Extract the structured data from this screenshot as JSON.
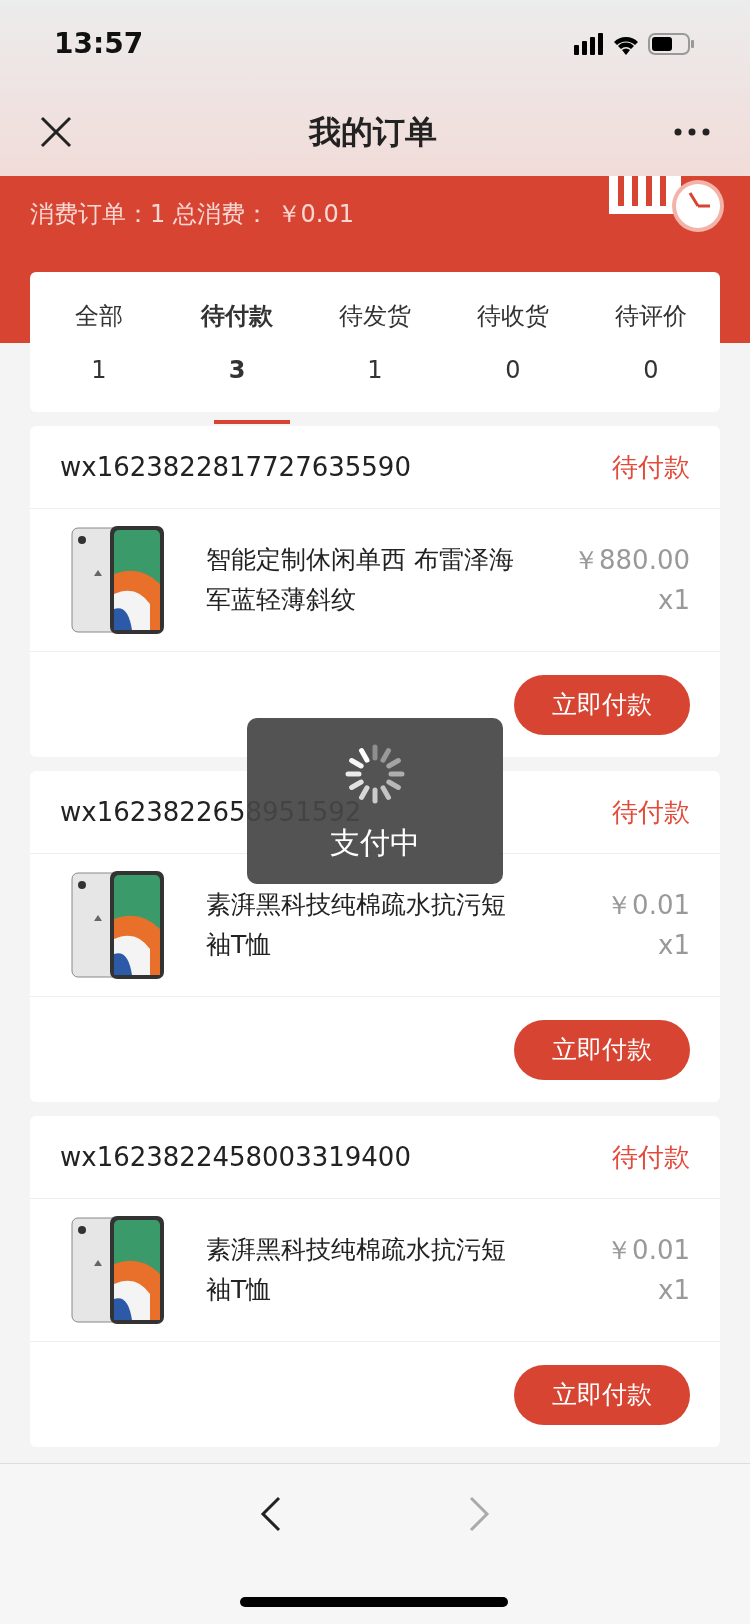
{
  "status_bar": {
    "time": "13:57"
  },
  "nav_bar": {
    "title": "我的订单"
  },
  "summary": {
    "text": "消费订单：1 总消费： ￥0.01"
  },
  "tabs": [
    {
      "label": "全部",
      "count": "1",
      "selected": false
    },
    {
      "label": "待付款",
      "count": "3",
      "selected": true
    },
    {
      "label": "待发货",
      "count": "1",
      "selected": false
    },
    {
      "label": "待收货",
      "count": "0",
      "selected": false
    },
    {
      "label": "待评价",
      "count": "0",
      "selected": false
    }
  ],
  "orders": [
    {
      "order_no": "wx1623822817727635590",
      "status": "待付款",
      "product": "智能定制休闲单西 布雷泽海军蓝轻薄斜纹",
      "price": "￥880.00",
      "quantity": "x1",
      "action": "立即付款"
    },
    {
      "order_no": "wx1623822658951592",
      "status": "待付款",
      "product": "素湃黑科技纯棉疏水抗污短袖T恤",
      "price": "￥0.01",
      "quantity": "x1",
      "action": "立即付款"
    },
    {
      "order_no": "wx1623822458003319400",
      "status": "待付款",
      "product": "素湃黑科技纯棉疏水抗污短袖T恤",
      "price": "￥0.01",
      "quantity": "x1",
      "action": "立即付款"
    }
  ],
  "toast": {
    "text": "支付中"
  },
  "browser_bar": {
    "back": {
      "disabled": false
    },
    "forward": {
      "disabled": true
    }
  }
}
